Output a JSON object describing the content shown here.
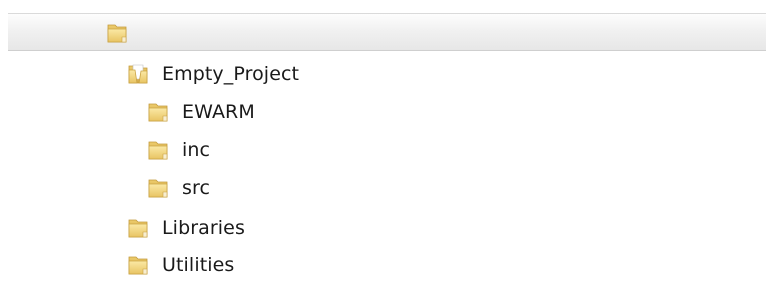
{
  "tree": {
    "items": [
      {
        "label": "",
        "icon": "folder-icon",
        "level": 0,
        "selected": true
      },
      {
        "label": "Empty_Project",
        "icon": "folder-open-icon",
        "level": 1
      },
      {
        "label": "EWARM",
        "icon": "folder-icon",
        "level": 2
      },
      {
        "label": "inc",
        "icon": "folder-icon",
        "level": 2
      },
      {
        "label": "src",
        "icon": "folder-icon",
        "level": 2
      },
      {
        "label": "Libraries",
        "icon": "folder-icon",
        "level": 1
      },
      {
        "label": "Utilities",
        "icon": "folder-icon",
        "level": 1
      }
    ]
  },
  "colors": {
    "folder_body": "#f3d77a",
    "folder_edge": "#c9a243",
    "selection_bg": "#ececec"
  }
}
